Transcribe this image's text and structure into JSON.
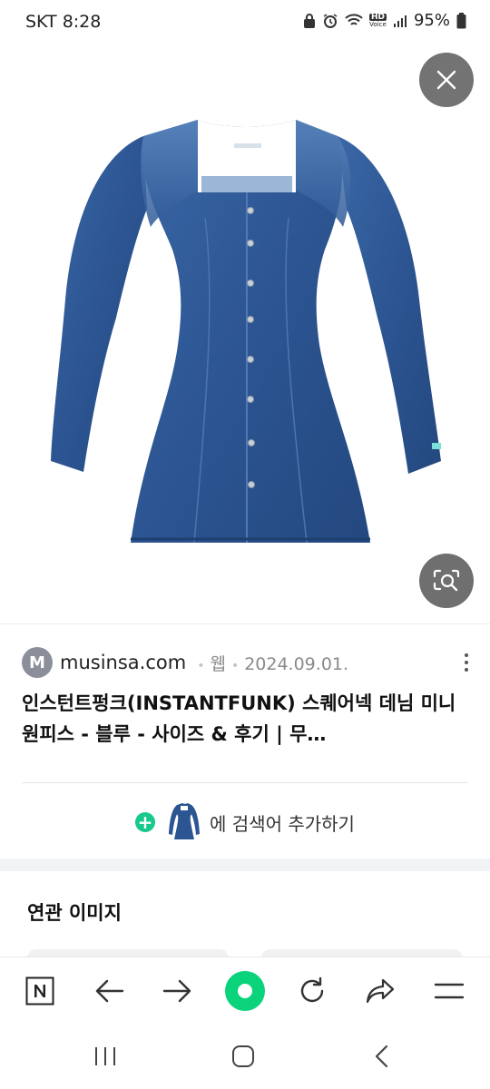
{
  "status_bar": {
    "carrier_time": "SKT 8:28",
    "battery": "95%",
    "hd_badge": "HD",
    "hd_sub": "Voice"
  },
  "result": {
    "favicon_letter": "M",
    "site": "musinsa.com",
    "type": "웹",
    "date": "2024.09.01.",
    "title": "인스턴트펑크(INSTANTFUNK) 스퀘어넥 데님 미니 원피스 - 블루 - 사이즈 & 후기 | 무…"
  },
  "add_query": {
    "label": "에 검색어 추가하기"
  },
  "related": {
    "heading": "연관 이미지"
  },
  "icons": {
    "close": "close-icon",
    "lens": "image-search-icon",
    "more": "more-vertical-icon",
    "home": "naver-n-icon",
    "back": "arrow-left-icon",
    "forward": "arrow-right-icon",
    "green_dot": "green-dot-icon",
    "refresh": "refresh-icon",
    "share": "share-icon",
    "menu": "menu-icon"
  },
  "colors": {
    "accent_green": "#03C75A",
    "denim": "#2f5a9a"
  }
}
